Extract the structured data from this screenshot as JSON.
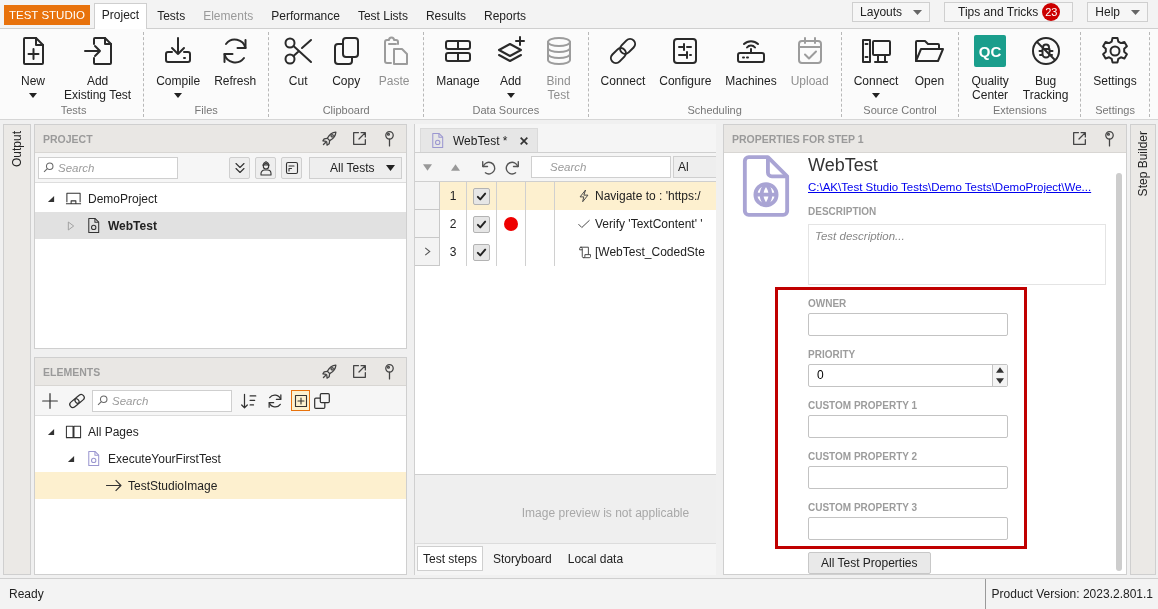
{
  "app_button": {
    "label": "TEST STUDIO"
  },
  "menu_tabs": [
    {
      "label": "Project",
      "selected": true,
      "disabled": false
    },
    {
      "label": "Tests",
      "selected": false,
      "disabled": false
    },
    {
      "label": "Elements",
      "selected": false,
      "disabled": true
    },
    {
      "label": "Performance",
      "selected": false,
      "disabled": false
    },
    {
      "label": "Test Lists",
      "selected": false,
      "disabled": false
    },
    {
      "label": "Results",
      "selected": false,
      "disabled": false
    },
    {
      "label": "Reports",
      "selected": false,
      "disabled": false
    }
  ],
  "top_controls": [
    {
      "kind": "dropdown",
      "label": "Layouts"
    },
    {
      "kind": "button",
      "label": "Tips and Tricks",
      "badge": "23"
    },
    {
      "kind": "dropdown",
      "label": "Help"
    }
  ],
  "ribbon": [
    {
      "label": "Tests",
      "buttons": [
        {
          "label": "New",
          "has_menu": true,
          "disabled": false
        },
        {
          "label": "Add\nExisting Test",
          "has_menu": false,
          "disabled": false
        }
      ]
    },
    {
      "label": "Files",
      "buttons": [
        {
          "label": "Compile",
          "has_menu": true,
          "disabled": false
        },
        {
          "label": "Refresh",
          "has_menu": false,
          "disabled": false
        }
      ]
    },
    {
      "label": "Clipboard",
      "buttons": [
        {
          "label": "Cut",
          "has_menu": false,
          "disabled": false
        },
        {
          "label": "Copy",
          "has_menu": false,
          "disabled": false
        },
        {
          "label": "Paste",
          "has_menu": false,
          "disabled": true
        }
      ]
    },
    {
      "label": "Data Sources",
      "buttons": [
        {
          "label": "Manage",
          "has_menu": false,
          "disabled": false
        },
        {
          "label": "Add",
          "has_menu": true,
          "disabled": false
        },
        {
          "label": "Bind\nTest",
          "has_menu": false,
          "disabled": true
        }
      ]
    },
    {
      "label": "Scheduling",
      "buttons": [
        {
          "label": "Connect",
          "has_menu": false,
          "disabled": false
        },
        {
          "label": "Configure",
          "has_menu": false,
          "disabled": false
        },
        {
          "label": "Machines",
          "has_menu": false,
          "disabled": false
        },
        {
          "label": "Upload",
          "has_menu": false,
          "disabled": true
        }
      ]
    },
    {
      "label": "Source Control",
      "buttons": [
        {
          "label": "Connect",
          "has_menu": true,
          "disabled": false
        },
        {
          "label": "Open",
          "has_menu": false,
          "disabled": false
        }
      ]
    },
    {
      "label": "Extensions",
      "buttons": [
        {
          "label": "Quality\nCenter",
          "icon_text": "QC",
          "has_menu": false,
          "disabled": false
        },
        {
          "label": "Bug\nTracking",
          "has_menu": false,
          "disabled": false
        }
      ]
    },
    {
      "label": "Settings",
      "buttons": [
        {
          "label": "Settings",
          "has_menu": false,
          "disabled": false
        }
      ]
    }
  ],
  "left_dock": {
    "tab": "Output"
  },
  "project_panel": {
    "title": "PROJECT",
    "search": {
      "placeholder": "Search"
    },
    "filter": {
      "value": "All Tests"
    },
    "tree": [
      {
        "label": "DemoProject",
        "kind": "project",
        "expanded": true,
        "selected": false,
        "active": false,
        "children": [
          {
            "label": "WebTest",
            "kind": "test",
            "expanded": false,
            "selected": true,
            "active": true
          }
        ]
      }
    ]
  },
  "elements_panel": {
    "title": "ELEMENTS",
    "search": {
      "placeholder": "Search"
    },
    "toolbar_toggle": {
      "on": true
    },
    "tree": [
      {
        "label": "All Pages",
        "kind": "pages",
        "expanded": true,
        "selected": false,
        "active": false,
        "children": [
          {
            "label": "ExecuteYourFirstTest",
            "kind": "page",
            "expanded": true,
            "selected": false,
            "active": false,
            "children": [
              {
                "label": "TestStudioImage",
                "kind": "element",
                "selected": true,
                "active": false
              }
            ]
          }
        ]
      }
    ]
  },
  "editor": {
    "tabs": [
      {
        "label": "WebTest *",
        "selected": true
      }
    ],
    "search": {
      "placeholder": "Search"
    },
    "filter_button": {
      "label": "Al"
    },
    "steps": [
      {
        "number": "1",
        "kind": "navigate",
        "checked": true,
        "breakpoint": false,
        "current": false,
        "selected": true,
        "text": "Navigate to : 'https:/"
      },
      {
        "number": "2",
        "kind": "verify",
        "checked": true,
        "breakpoint": true,
        "current": false,
        "selected": false,
        "text": "Verify 'TextContent' '"
      },
      {
        "number": "3",
        "kind": "coded",
        "checked": true,
        "breakpoint": false,
        "current": true,
        "selected": false,
        "text": "[WebTest_CodedSte"
      }
    ],
    "preview_message": "Image preview is not applicable",
    "bottom_tabs": [
      {
        "label": "Test steps",
        "selected": true
      },
      {
        "label": "Storyboard",
        "selected": false
      },
      {
        "label": "Local data",
        "selected": false
      }
    ]
  },
  "properties": {
    "title": "PROPERTIES FOR STEP 1",
    "name": "WebTest",
    "path": "C:\\AK\\Test Studio Tests\\Demo Tests\\DemoProject\\We...",
    "description": {
      "label": "DESCRIPTION",
      "placeholder": "Test description..."
    },
    "fields_group": {
      "outlined": true,
      "fields": [
        {
          "label": "OWNER",
          "kind": "text"
        },
        {
          "label": "PRIORITY",
          "kind": "spinner",
          "value": "0"
        },
        {
          "label": "CUSTOM PROPERTY 1",
          "kind": "text"
        },
        {
          "label": "CUSTOM PROPERTY 2",
          "kind": "text"
        },
        {
          "label": "CUSTOM PROPERTY 3",
          "kind": "text"
        }
      ]
    },
    "button": {
      "label": "All Test Properties"
    }
  },
  "right_dock": {
    "tab": "Step Builder"
  },
  "status_bar": {
    "message": "Ready",
    "version": "Product Version: 2023.2.801.1"
  }
}
